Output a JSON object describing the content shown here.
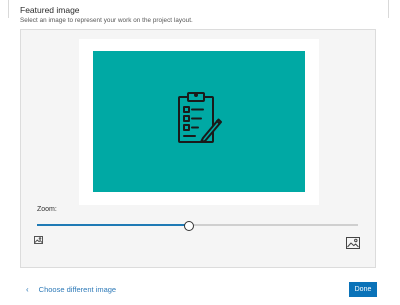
{
  "header": {
    "title": "Featured image",
    "subtitle": "Select an image to represent your work on the project layout."
  },
  "preview": {
    "background_color": "#00a9a4",
    "icon": "clipboard-checklist-pencil-icon"
  },
  "zoom": {
    "label": "Zoom:",
    "value_fraction": 0.47,
    "min_icon": "image-small-icon",
    "max_icon": "image-large-icon"
  },
  "footer": {
    "back_icon": "chevron-left-icon",
    "choose_label": "Choose different image",
    "done_label": "Done"
  },
  "colors": {
    "accent": "#0a72b8",
    "link": "#2e7ab8"
  }
}
